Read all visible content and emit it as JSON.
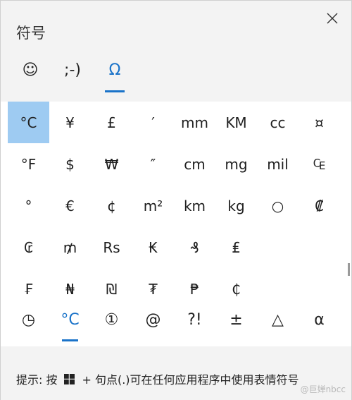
{
  "window": {
    "title": "符号"
  },
  "tabs": [
    {
      "label": "☺",
      "icon": "smiley-icon",
      "active": false
    },
    {
      "label": ";-)",
      "icon": "kaomoji-icon",
      "active": false
    },
    {
      "label": "Ω",
      "icon": "omega-icon",
      "active": true
    }
  ],
  "symbols": [
    "°C",
    "¥",
    "£",
    "′",
    "mm",
    "KM",
    "cc",
    "¤",
    "°F",
    "$",
    "₩",
    "″",
    "cm",
    "mg",
    "mil",
    "₠",
    "°",
    "€",
    "¢",
    "m²",
    "km",
    "kg",
    "○",
    "₡",
    "₢",
    "₥",
    "Rs",
    "₭",
    "₰",
    "₤",
    "",
    "",
    "₣",
    "₦",
    "₪",
    "₮",
    "₱",
    "₵",
    "",
    ""
  ],
  "selected_symbol_index": 0,
  "categories": [
    {
      "label": "◷",
      "icon": "clock-icon",
      "active": false
    },
    {
      "label": "°C",
      "icon": "unit-symbols-icon",
      "active": true
    },
    {
      "label": "①",
      "icon": "circled-number-icon",
      "active": false
    },
    {
      "label": "@",
      "icon": "at-sign-icon",
      "active": false
    },
    {
      "label": "?!",
      "icon": "punctuation-icon",
      "active": false
    },
    {
      "label": "±",
      "icon": "math-icon",
      "active": false
    },
    {
      "label": "△",
      "icon": "triangle-icon",
      "active": false
    },
    {
      "label": "α",
      "icon": "greek-letter-icon",
      "active": false
    }
  ],
  "footer": {
    "hint_prefix": "提示: 按",
    "hint_suffix": "+ 句点(.)可在任何应用程序中使用表情符号",
    "watermark": "@巨婵nbcc"
  },
  "colors": {
    "accent": "#1a73c9",
    "selected_cell": "#9ecbf2",
    "panel_bg": "#f3f3f3",
    "grid_bg": "#ffffff"
  }
}
